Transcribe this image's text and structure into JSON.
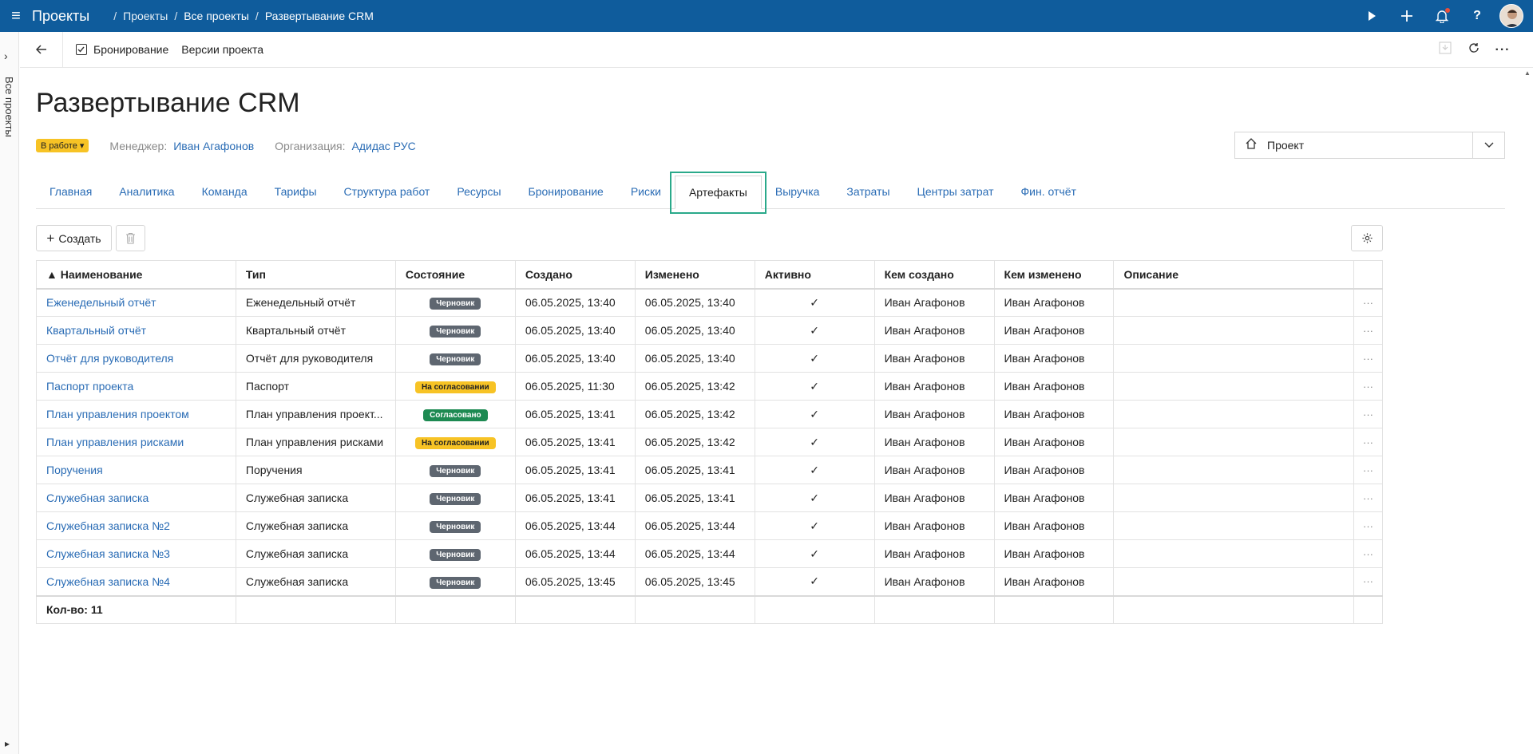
{
  "topbar": {
    "app_title": "Проекты",
    "breadcrumb": [
      "Проекты",
      "Все проекты",
      "Развертывание CRM"
    ]
  },
  "leftrail": {
    "label": "Все проекты"
  },
  "subbar": {
    "booking_label": "Бронирование",
    "versions_label": "Версии проекта"
  },
  "page": {
    "title": "Развертывание CRM",
    "status": "В работе",
    "manager_label": "Менеджер:",
    "manager": "Иван Агафонов",
    "org_label": "Организация:",
    "org": "Адидас РУС",
    "project_select": "Проект"
  },
  "tabs": [
    "Главная",
    "Аналитика",
    "Команда",
    "Тарифы",
    "Структура работ",
    "Ресурсы",
    "Бронирование",
    "Риски",
    "Артефакты",
    "Выручка",
    "Затраты",
    "Центры затрат",
    "Фин. отчёт"
  ],
  "actions": {
    "create_label": "Создать"
  },
  "table": {
    "headers": [
      "▲ Наименование",
      "Тип",
      "Состояние",
      "Создано",
      "Изменено",
      "Активно",
      "Кем создано",
      "Кем изменено",
      "Описание"
    ],
    "rows": [
      {
        "name": "Еженедельный отчёт",
        "type": "Еженедельный отчёт",
        "state": "Черновик",
        "state_kind": "draft",
        "created": "06.05.2025, 13:40",
        "modified": "06.05.2025, 13:40",
        "active": "✓",
        "created_by": "Иван Агафонов",
        "modified_by": "Иван Агафонов",
        "description": ""
      },
      {
        "name": "Квартальный отчёт",
        "type": "Квартальный отчёт",
        "state": "Черновик",
        "state_kind": "draft",
        "created": "06.05.2025, 13:40",
        "modified": "06.05.2025, 13:40",
        "active": "✓",
        "created_by": "Иван Агафонов",
        "modified_by": "Иван Агафонов",
        "description": ""
      },
      {
        "name": "Отчёт для руководителя",
        "type": "Отчёт для руководителя",
        "state": "Черновик",
        "state_kind": "draft",
        "created": "06.05.2025, 13:40",
        "modified": "06.05.2025, 13:40",
        "active": "✓",
        "created_by": "Иван Агафонов",
        "modified_by": "Иван Агафонов",
        "description": ""
      },
      {
        "name": "Паспорт проекта",
        "type": "Паспорт",
        "state": "На согласовании",
        "state_kind": "review",
        "created": "06.05.2025, 11:30",
        "modified": "06.05.2025, 13:42",
        "active": "✓",
        "created_by": "Иван Агафонов",
        "modified_by": "Иван Агафонов",
        "description": ""
      },
      {
        "name": "План управления проектом",
        "type": "План управления проект...",
        "state": "Согласовано",
        "state_kind": "approved",
        "created": "06.05.2025, 13:41",
        "modified": "06.05.2025, 13:42",
        "active": "✓",
        "created_by": "Иван Агафонов",
        "modified_by": "Иван Агафонов",
        "description": ""
      },
      {
        "name": "План управления рисками",
        "type": "План управления рисками",
        "state": "На согласовании",
        "state_kind": "review",
        "created": "06.05.2025, 13:41",
        "modified": "06.05.2025, 13:42",
        "active": "✓",
        "created_by": "Иван Агафонов",
        "modified_by": "Иван Агафонов",
        "description": ""
      },
      {
        "name": "Поручения",
        "type": "Поручения",
        "state": "Черновик",
        "state_kind": "draft",
        "created": "06.05.2025, 13:41",
        "modified": "06.05.2025, 13:41",
        "active": "✓",
        "created_by": "Иван Агафонов",
        "modified_by": "Иван Агафонов",
        "description": ""
      },
      {
        "name": "Служебная записка",
        "type": "Служебная записка",
        "state": "Черновик",
        "state_kind": "draft",
        "created": "06.05.2025, 13:41",
        "modified": "06.05.2025, 13:41",
        "active": "✓",
        "created_by": "Иван Агафонов",
        "modified_by": "Иван Агафонов",
        "description": ""
      },
      {
        "name": "Служебная записка №2",
        "type": "Служебная записка",
        "state": "Черновик",
        "state_kind": "draft",
        "created": "06.05.2025, 13:44",
        "modified": "06.05.2025, 13:44",
        "active": "✓",
        "created_by": "Иван Агафонов",
        "modified_by": "Иван Агафонов",
        "description": ""
      },
      {
        "name": "Служебная записка №3",
        "type": "Служебная записка",
        "state": "Черновик",
        "state_kind": "draft",
        "created": "06.05.2025, 13:44",
        "modified": "06.05.2025, 13:44",
        "active": "✓",
        "created_by": "Иван Агафонов",
        "modified_by": "Иван Агафонов",
        "description": ""
      },
      {
        "name": "Служебная записка №4",
        "type": "Служебная записка",
        "state": "Черновик",
        "state_kind": "draft",
        "created": "06.05.2025, 13:45",
        "modified": "06.05.2025, 13:45",
        "active": "✓",
        "created_by": "Иван Агафонов",
        "modified_by": "Иван Агафонов",
        "description": ""
      }
    ],
    "footer": "Кол-во: 11"
  },
  "colors": {
    "topbar": "#0f5c9c",
    "link": "#2a6cb5",
    "status_in_work": "#f7c325",
    "badge_draft": "#5e6670",
    "badge_review": "#f7c325",
    "badge_approved": "#1d8a52",
    "tab_highlight": "#2aa98a"
  },
  "icons": [
    "menu-icon",
    "play-icon",
    "plus-icon",
    "bell-icon",
    "help-icon",
    "back-arrow-icon",
    "calendar-check-icon",
    "download-icon",
    "refresh-icon",
    "more-icon",
    "home-icon",
    "chevron-down-icon",
    "trash-icon",
    "gear-icon",
    "row-menu-icon"
  ]
}
